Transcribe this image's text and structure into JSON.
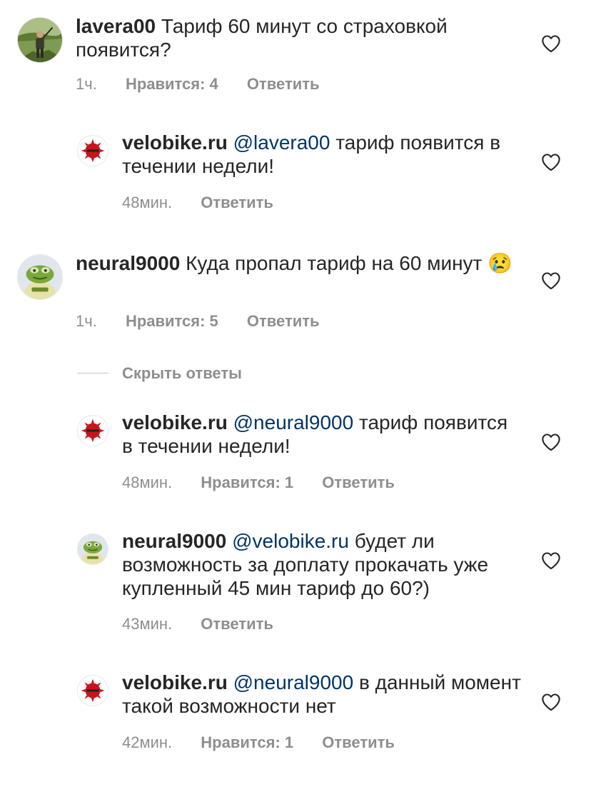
{
  "comments": [
    {
      "username": "lavera00",
      "mention": "",
      "text": "Тариф 60 минут со страховкой появится?",
      "time": "1ч.",
      "likes": "Нравится: 4",
      "reply": "Ответить",
      "avatar_icon": "user-photo-avatar"
    },
    {
      "username": "velobike.ru",
      "mention": "@lavera00",
      "text": "тариф появится в течении недели!",
      "time": "48мин.",
      "likes": "",
      "reply": "Ответить",
      "avatar_icon": "velobike-logo-avatar"
    },
    {
      "username": "neural9000",
      "mention": "",
      "text": "Куда пропал тариф на 60 минут 😢",
      "time": "1ч.",
      "likes": "Нравится: 5",
      "reply": "Ответить",
      "avatar_icon": "frog-avatar"
    },
    {
      "username": "velobike.ru",
      "mention": "@neural9000",
      "text": "тариф появится в течении недели!",
      "time": "48мин.",
      "likes": "Нравится: 1",
      "reply": "Ответить",
      "avatar_icon": "velobike-logo-avatar"
    },
    {
      "username": "neural9000",
      "mention": "@velobike.ru",
      "text": "будет ли возможность за доплату прокачать уже купленный 45 мин тариф до 60?)",
      "time": "43мин.",
      "likes": "",
      "reply": "Ответить",
      "avatar_icon": "frog-avatar"
    },
    {
      "username": "velobike.ru",
      "mention": "@neural9000",
      "text": "в данный момент такой возможности нет",
      "time": "42мин.",
      "likes": "Нравится: 1",
      "reply": "Ответить",
      "avatar_icon": "velobike-logo-avatar"
    }
  ],
  "hide_replies_label": "Скрыть ответы",
  "icons": {
    "like": "heart-outline-icon"
  },
  "colors": {
    "text": "#262626",
    "muted": "#8e8e8e",
    "mention": "#003569",
    "divider": "#c7c7c7"
  }
}
